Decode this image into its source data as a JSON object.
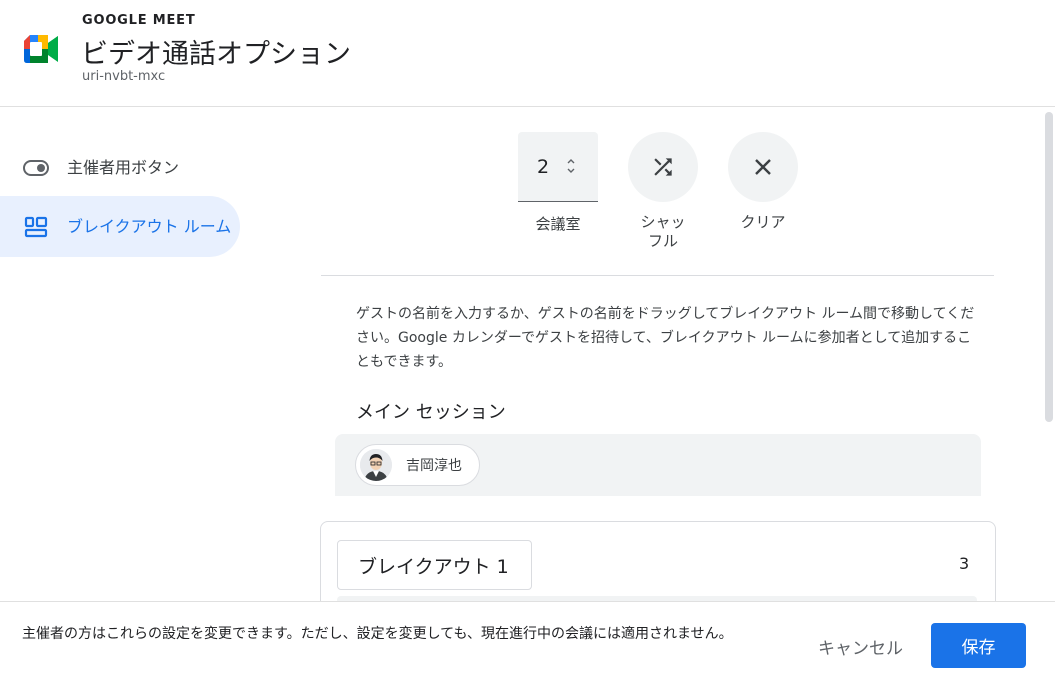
{
  "header": {
    "app_name": "GOOGLE MEET",
    "title": "ビデオ通話オプション",
    "meeting_code": "uri-nvbt-mxc"
  },
  "sidebar": {
    "items": [
      {
        "label": "主催者用ボタン",
        "icon": "toggle-icon",
        "selected": false
      },
      {
        "label": "ブレイクアウト ルーム",
        "icon": "breakout-rooms-icon",
        "selected": true
      }
    ]
  },
  "controls": {
    "room_count": "2",
    "room_count_label": "会議室",
    "shuffle_label": "シャッフル",
    "clear_label": "クリア"
  },
  "content": {
    "description": "ゲストの名前を入力するか、ゲストの名前をドラッグしてブレイクアウト ルーム間で移動してください。Google カレンダーでゲストを招待して、ブレイクアウト ルームに参加者として追加することもできます。",
    "main_session_title": "メイン セッション",
    "main_session_participants": [
      {
        "name": "吉岡淳也"
      }
    ],
    "rooms": [
      {
        "name": "ブレイクアウト 1",
        "participant_count": "3"
      }
    ]
  },
  "footer": {
    "note": "主催者の方はこれらの設定を変更できます。ただし、設定を変更しても、現在進行中の会議には適用されません。",
    "cancel_label": "キャンセル",
    "save_label": "保存"
  },
  "colors": {
    "accent": "#1a73e8",
    "selected_bg": "#e8f0fe",
    "button_bg": "#f1f3f4"
  }
}
